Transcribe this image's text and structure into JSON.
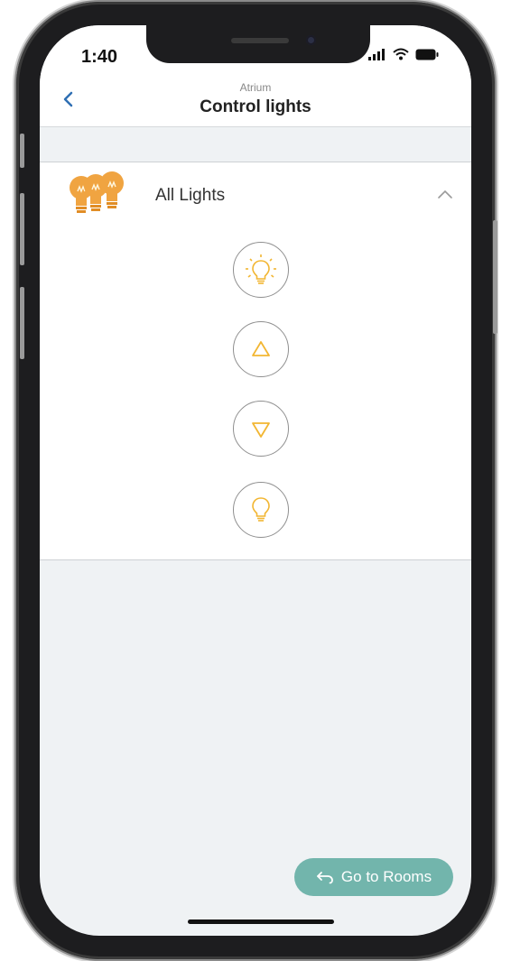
{
  "status_bar": {
    "time": "1:40"
  },
  "header": {
    "subtitle": "Atrium",
    "title": "Control lights"
  },
  "group": {
    "label": "All Lights"
  },
  "controls": [
    {
      "name": "light-on-icon"
    },
    {
      "name": "brighten-up-icon"
    },
    {
      "name": "dim-down-icon"
    },
    {
      "name": "light-off-icon"
    }
  ],
  "footer": {
    "go_rooms_label": "Go to Rooms"
  },
  "colors": {
    "accent_blue": "#2f6fb3",
    "bulb_orange": "#f0a441",
    "icon_yellow": "#f2b632",
    "pill_teal": "#72b5ac"
  }
}
